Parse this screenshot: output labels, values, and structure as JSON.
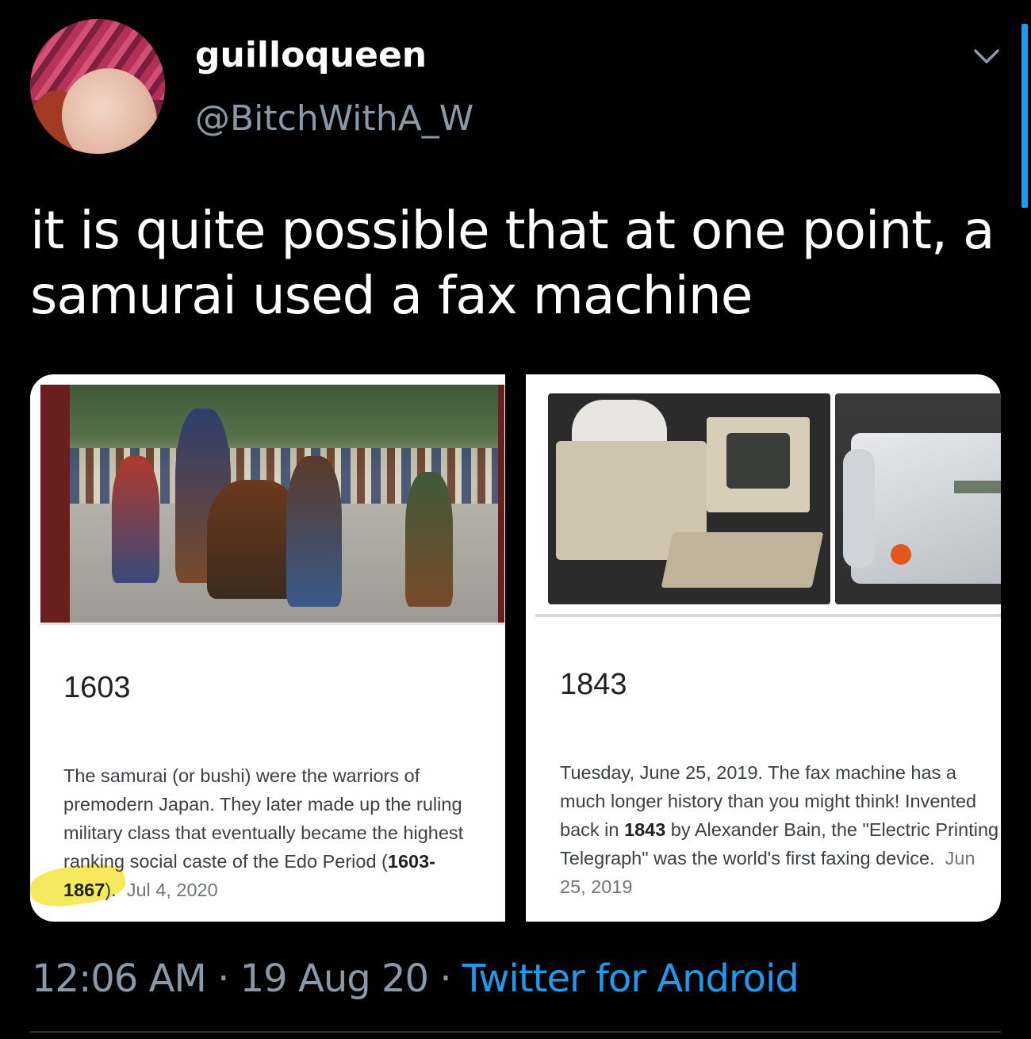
{
  "tweet": {
    "display_name": "guilloqueen",
    "handle": "@BitchWithA_W",
    "text": "it is quite possible that at one point, a samurai used a fax machine",
    "timestamp": "12:06 AM",
    "date": "19 Aug 20",
    "separator": "·",
    "source": "Twitter for Android"
  },
  "cards": [
    {
      "year": "1603",
      "body_parts": {
        "text": "The samurai (or bushi) were the warriors of premodern Japan. They later made up the ruling military class that eventually became the highest ranking social caste of the Edo Period (",
        "bold": "1603-1867",
        "after": ").",
        "date": "Jul 4, 2020"
      }
    },
    {
      "year": "1843",
      "body_parts": {
        "text": "Tuesday, June 25, 2019. The fax machine has a much longer history than you might think! Invented back in ",
        "bold": "1843",
        "after": " by Alexander Bain, the \"Electric Printing Telegraph\" was the world's first faxing device.",
        "date": "Jun 25, 2019"
      }
    }
  ],
  "colors": {
    "background": "#000000",
    "link": "#1d9bf0",
    "muted": "#8b98a5",
    "highlight": "#f4e542"
  },
  "icons": {
    "menu": "chevron-down-icon"
  }
}
